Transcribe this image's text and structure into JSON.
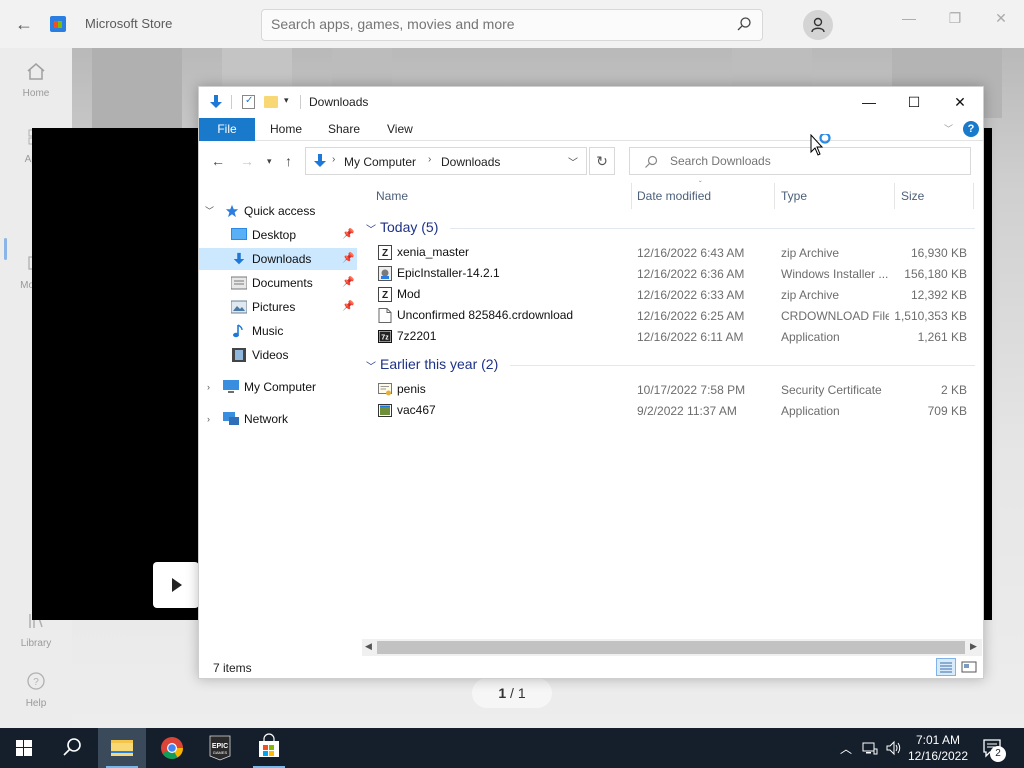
{
  "store": {
    "title": "Microsoft Store",
    "search_placeholder": "Search apps, games, movies and more",
    "nav": [
      {
        "label": "Home",
        "icon": "home-icon"
      },
      {
        "label": "Apps",
        "icon": "apps-icon"
      },
      {
        "label": "Movies",
        "icon": "movies-icon"
      },
      {
        "label": "Library",
        "icon": "library-icon"
      },
      {
        "label": "Help",
        "icon": "help-icon"
      }
    ],
    "pager_current": "1",
    "pager_total": " / 1"
  },
  "explorer": {
    "title": "Downloads",
    "ribbon_tabs": [
      "File",
      "Home",
      "Share",
      "View"
    ],
    "breadcrumb": [
      "My Computer",
      "Downloads"
    ],
    "search_placeholder": "Search Downloads",
    "nav_tree": [
      {
        "label": "Quick access",
        "icon": "star-icon",
        "expander": "down"
      },
      {
        "label": "Desktop",
        "icon": "desktop-icon",
        "pinned": true
      },
      {
        "label": "Downloads",
        "icon": "download-arrow-icon",
        "pinned": true,
        "selected": true
      },
      {
        "label": "Documents",
        "icon": "documents-icon",
        "pinned": true
      },
      {
        "label": "Pictures",
        "icon": "pictures-icon",
        "pinned": true
      },
      {
        "label": "Music",
        "icon": "music-icon"
      },
      {
        "label": "Videos",
        "icon": "videos-icon"
      },
      {
        "label": "My Computer",
        "icon": "computer-icon",
        "expander": "right"
      },
      {
        "label": "Network",
        "icon": "network-icon",
        "expander": "right"
      }
    ],
    "columns": [
      "Name",
      "Date modified",
      "Type",
      "Size"
    ],
    "groups": [
      {
        "label": "Today (5)",
        "files": [
          {
            "name": "xenia_master",
            "date": "12/16/2022 6:43 AM",
            "type": "zip Archive",
            "size": "16,930 KB",
            "icon": "zip-icon"
          },
          {
            "name": "EpicInstaller-14.2.1",
            "date": "12/16/2022 6:36 AM",
            "type": "Windows Installer ...",
            "size": "156,180 KB",
            "icon": "installer-icon"
          },
          {
            "name": "Mod",
            "date": "12/16/2022 6:33 AM",
            "type": "zip Archive",
            "size": "12,392 KB",
            "icon": "zip-icon"
          },
          {
            "name": "Unconfirmed 825846.crdownload",
            "date": "12/16/2022 6:25 AM",
            "type": "CRDOWNLOAD File",
            "size": "1,510,353 KB",
            "icon": "blank-file-icon"
          },
          {
            "name": "7z2201",
            "date": "12/16/2022 6:11 AM",
            "type": "Application",
            "size": "1,261 KB",
            "icon": "7zip-icon"
          }
        ]
      },
      {
        "label": "Earlier this year (2)",
        "files": [
          {
            "name": "penis",
            "date": "10/17/2022 7:58 PM",
            "type": "Security Certificate",
            "size": "2 KB",
            "icon": "certificate-icon"
          },
          {
            "name": "vac467",
            "date": "9/2/2022 11:37 AM",
            "type": "Application",
            "size": "709 KB",
            "icon": "app-icon"
          }
        ]
      }
    ],
    "status_count": "7 items"
  },
  "taskbar": {
    "apps": [
      "start",
      "search",
      "file-explorer",
      "chrome",
      "epic-games",
      "microsoft-store"
    ],
    "time": "7:01 AM",
    "date": "12/16/2022",
    "notification_count": "2"
  },
  "colors": {
    "accent": "#1979ca",
    "selection": "#cce8ff",
    "group_header": "#1e3287",
    "taskbar": "#141f2b"
  }
}
